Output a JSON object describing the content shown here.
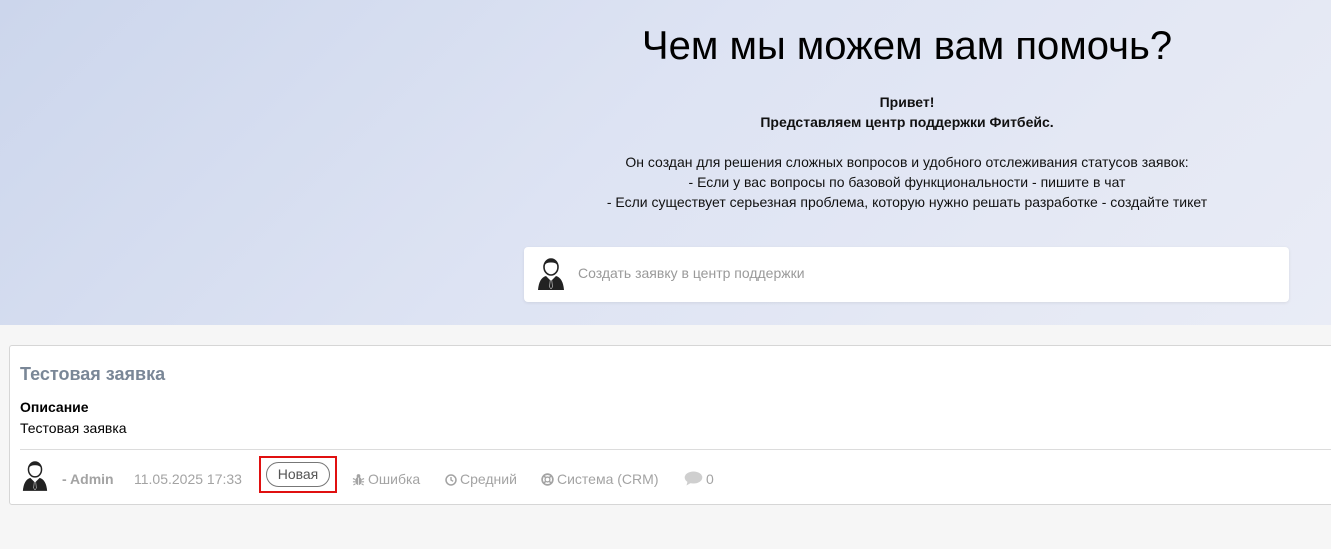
{
  "hero": {
    "title": "Чем мы можем вам помочь?",
    "greeting": "Привет!",
    "intro": "Представляем центр поддержки Фитбейс.",
    "description": "Он создан для решения сложных вопросов и удобного отслеживания статусов заявок:",
    "bullet_chat": "- Если у вас вопросы по базовой функциональности - пишите в чат",
    "bullet_ticket": "- Если существует серьезная проблема, которую нужно решать разработке - создайте тикет"
  },
  "create_ticket": {
    "placeholder": "Создать заявку в центр поддержки",
    "avatar_icon": "user-avatar-icon"
  },
  "ticket": {
    "title": "Тестовая заявка",
    "description_label": "Описание",
    "description": "Тестовая заявка",
    "author": "- Admin",
    "date": "11.05.2025 17:33",
    "status": "Новая",
    "type": "Ошибка",
    "priority": "Средний",
    "component": "Система (CRM)",
    "comments_count": "0",
    "icons": {
      "type": "bug-icon",
      "priority": "clock-icon",
      "component": "lifebuoy-icon",
      "comments": "comment-bubble-icon"
    }
  },
  "colors": {
    "highlight": "#e01010",
    "title_muted": "#7a8797",
    "meta_gray": "#a3a3a3"
  }
}
